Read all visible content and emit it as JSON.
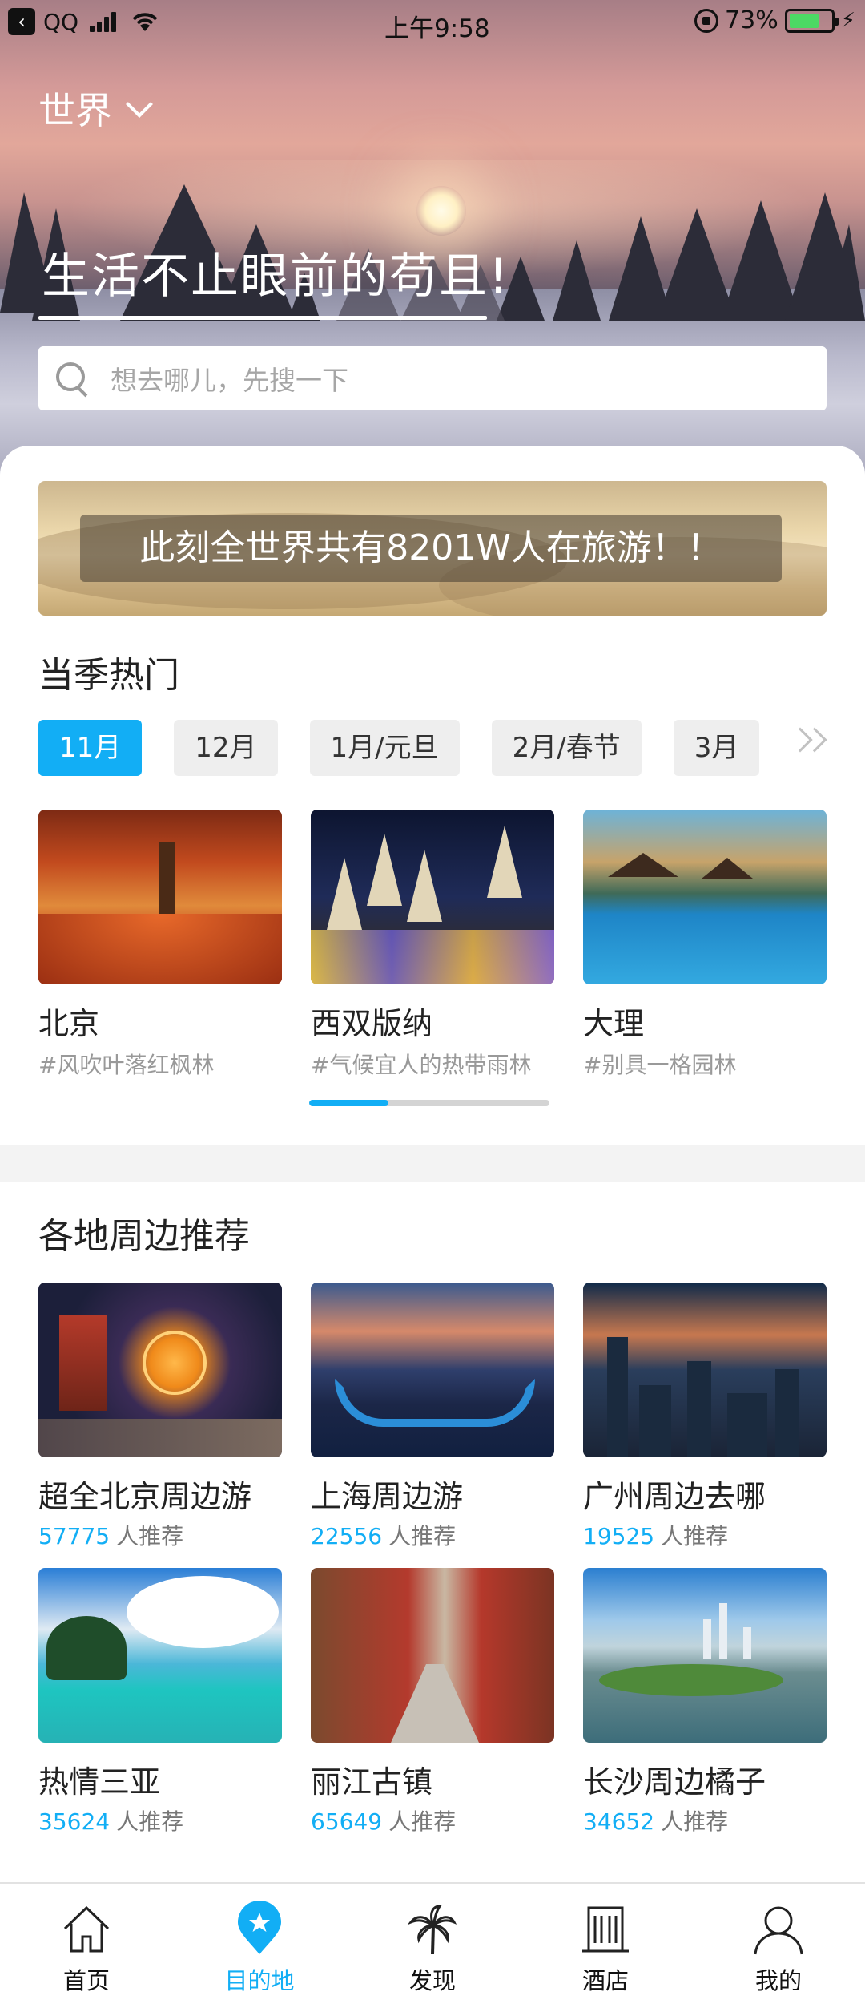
{
  "status_bar": {
    "back_glyph": "‹",
    "carrier": "QQ",
    "time": "上午9:58",
    "battery_percent": "73%",
    "battery_level": 0.73,
    "charging_glyph": "⚡"
  },
  "header": {
    "region": "世界",
    "slogan": "生活不止眼前的苟且!",
    "search_placeholder": "想去哪儿，先搜一下"
  },
  "banner": {
    "text": "此刻全世界共有8201W人在旅游！！"
  },
  "seasonal": {
    "title": "当季热门",
    "tabs": [
      "11月",
      "12月",
      "1月/元旦",
      "2月/春节",
      "3月"
    ],
    "active_tab": 0,
    "scroll_progress": 0.33,
    "cards": [
      {
        "name": "北京",
        "tag": "#风吹叶落红枫林"
      },
      {
        "name": "西双版纳",
        "tag": "#气候宜人的热带雨林"
      },
      {
        "name": "大理",
        "tag": "#别具一格园林"
      }
    ]
  },
  "nearby": {
    "title": "各地周边推荐",
    "rec_suffix": "人推荐",
    "cards": [
      {
        "name": "超全北京周边游",
        "count": "57775"
      },
      {
        "name": "上海周边游",
        "count": "22556"
      },
      {
        "name": "广州周边去哪",
        "count": "19525"
      },
      {
        "name": "热情三亚",
        "count": "35624"
      },
      {
        "name": "丽江古镇",
        "count": "65649"
      },
      {
        "name": "长沙周边橘子",
        "count": "34652"
      }
    ]
  },
  "tabbar": {
    "items": [
      {
        "label": "首页",
        "icon": "home-icon"
      },
      {
        "label": "目的地",
        "icon": "location-star-icon"
      },
      {
        "label": "发现",
        "icon": "palm-tree-icon"
      },
      {
        "label": "酒店",
        "icon": "hotel-building-icon"
      },
      {
        "label": "我的",
        "icon": "user-icon"
      }
    ],
    "active_index": 1
  },
  "colors": {
    "accent": "#12aef5",
    "tab_inactive_bg": "#eeeeee",
    "muted_text": "#999999"
  }
}
